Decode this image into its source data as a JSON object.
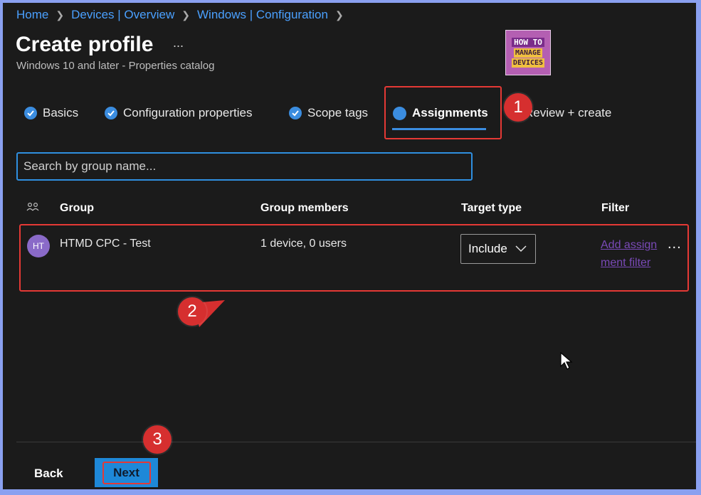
{
  "breadcrumb": [
    {
      "label": "Home"
    },
    {
      "label": "Devices | Overview"
    },
    {
      "label": "Windows | Configuration"
    }
  ],
  "page": {
    "title": "Create profile",
    "more_label": "...",
    "subtitle": "Windows 10 and later - Properties catalog"
  },
  "logo": {
    "line1": "HOW TO",
    "line2": "MANAGE",
    "line3": "DEVICES"
  },
  "tabs": [
    {
      "label": "Basics",
      "state": "completed"
    },
    {
      "label": "Configuration properties",
      "state": "completed"
    },
    {
      "label": "Scope tags",
      "state": "completed"
    },
    {
      "label": "Assignments",
      "state": "active"
    },
    {
      "label": "Review + create",
      "state": "pending"
    }
  ],
  "search": {
    "placeholder": "Search by group name..."
  },
  "table": {
    "headers": {
      "group": "Group",
      "members": "Group members",
      "target": "Target type",
      "filter": "Filter"
    },
    "rows": [
      {
        "initials": "HT",
        "group": "HTMD CPC - Test",
        "members": "1 device, 0 users",
        "target_type": "Include",
        "filter_link": "Add assignment filter",
        "more": "..."
      }
    ]
  },
  "annotations": {
    "step1": "1",
    "step2": "2",
    "step3": "3"
  },
  "footer": {
    "back_label": "Back",
    "next_label": "Next"
  },
  "colors": {
    "accent": "#3b8de0",
    "annotation_red": "#e53935",
    "background": "#1b1b1b",
    "link": "#4aa0ff"
  }
}
